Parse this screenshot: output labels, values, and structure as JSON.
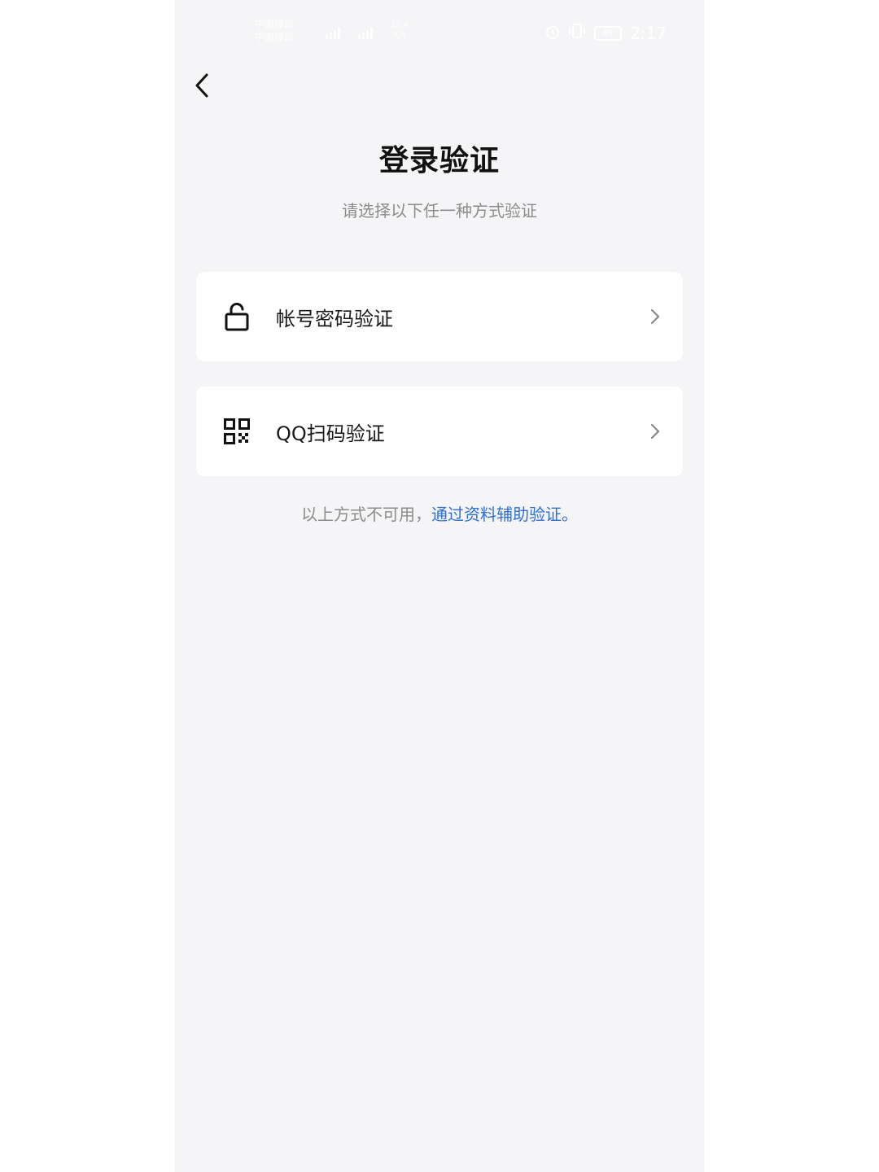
{
  "status_bar": {
    "carrier_line1": "中国移动",
    "carrier_line2": "中国移动",
    "net_speed_value": "12.6",
    "net_speed_unit": "K/s",
    "battery": "69",
    "time": "2:17"
  },
  "header": {
    "title": "登录验证",
    "subtitle": "请选择以下任一种方式验证"
  },
  "options": [
    {
      "label": "帐号密码验证",
      "icon": "lock-icon"
    },
    {
      "label": "QQ扫码验证",
      "icon": "qr-code-icon"
    }
  ],
  "footer": {
    "note": "以上方式不可用，",
    "link": "通过资料辅助验证。"
  },
  "colors": {
    "background": "#f5f5f7",
    "card": "#ffffff",
    "link": "#2d6fd6",
    "muted": "#8c8c8c"
  }
}
